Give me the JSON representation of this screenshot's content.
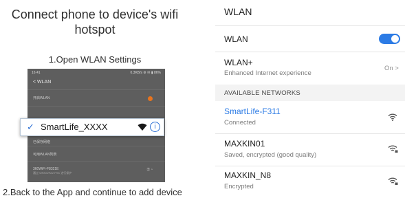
{
  "left": {
    "heading": "Connect phone to device's wifi hotspot",
    "step1": "1.Open WLAN Settings",
    "step2": "2.Back to the App and continue to add device",
    "phone": {
      "status_left": "16:41",
      "status_right": "0.3KB/s ⚙ ✉ ▮ 86%",
      "title": "< WLAN",
      "rows": [
        {
          "title": "开启WLAN",
          "sub": ""
        },
        {
          "title": "",
          "sub": ""
        },
        {
          "title": "已保存网络",
          "sub": ""
        },
        {
          "title": "可用WLAN列表",
          "sub": ""
        },
        {
          "title": "360WiFi-F8321E",
          "sub": "通过 WPA/WPA2 PSK 进行保护"
        }
      ]
    },
    "popup": {
      "check": "✓",
      "ssid": "SmartLife_XXXX",
      "info": "i"
    }
  },
  "right": {
    "title": "WLAN",
    "wlan_label": "WLAN",
    "wlan_enabled": true,
    "wlanplus_label": "WLAN+",
    "wlanplus_sub": "Enhanced Internet experience",
    "wlanplus_value": "On >",
    "section_header": "AVAILABLE NETWORKS",
    "networks": [
      {
        "name": "SmartLife-F311",
        "status": "Connected",
        "color": "#2c7be5",
        "locked": false
      },
      {
        "name": "MAXKIN01",
        "status": "Saved, encrypted (good quality)",
        "color": "#1f1f1f",
        "locked": true
      },
      {
        "name": "MAXKIN_N8",
        "status": "Encrypted",
        "color": "#1f1f1f",
        "locked": true
      }
    ],
    "icons": {
      "toggle": "toggle-switch",
      "wifi": "wifi-signal-icon",
      "wifi_lock": "wifi-lock-icon"
    }
  }
}
